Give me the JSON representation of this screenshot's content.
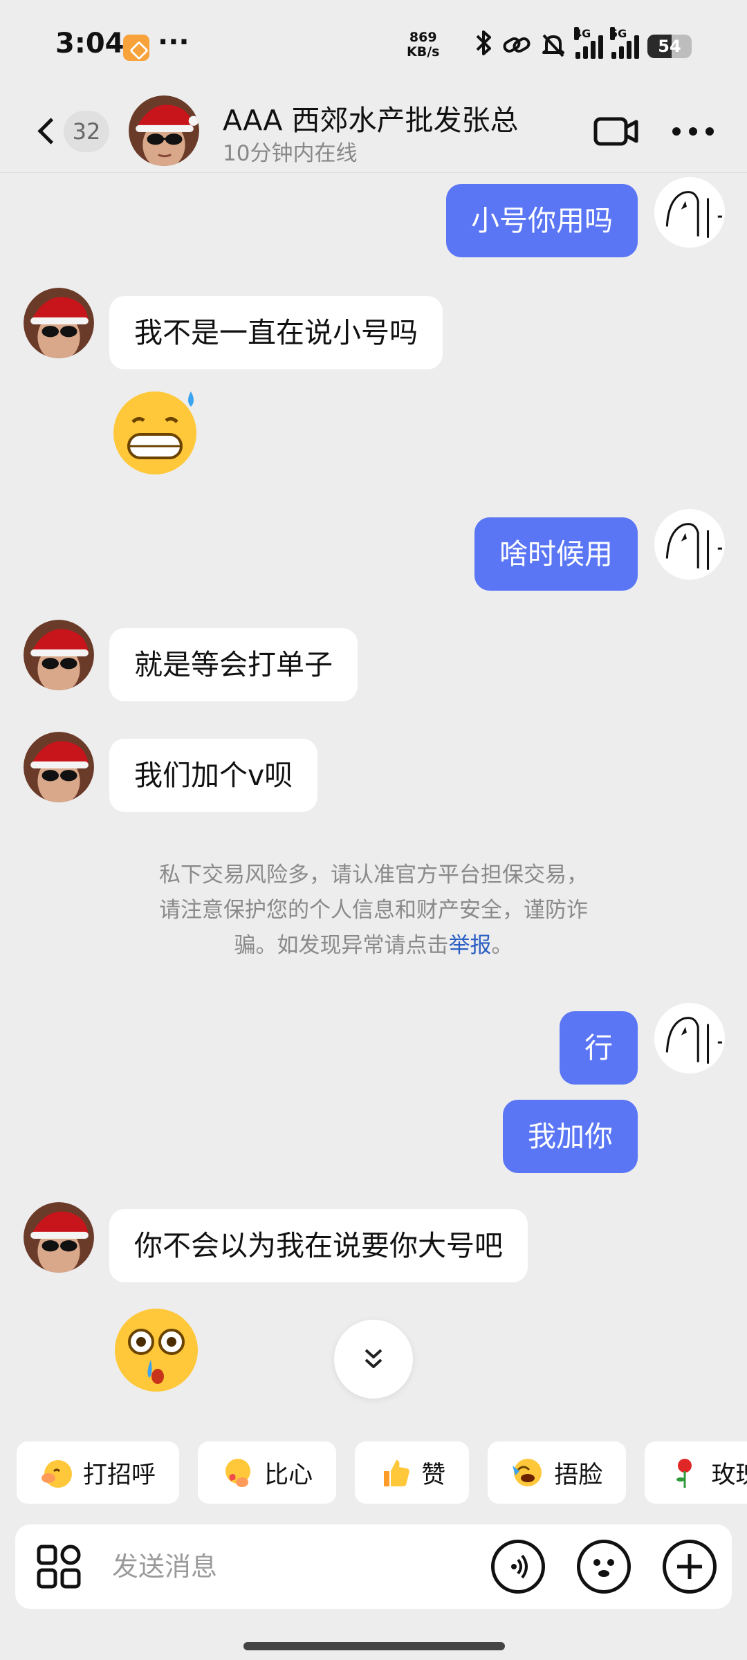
{
  "status_bar": {
    "time": "3:04",
    "speed_value": "869",
    "speed_unit": "KB/s",
    "net1": "4G",
    "net2": "5G",
    "battery": "54",
    "battery_level": 54
  },
  "header": {
    "unread_count": "32",
    "title": "AAA 西郊水产批发张总",
    "subtitle": "10分钟内在线"
  },
  "messages": [
    {
      "side": "out",
      "text": "小号你用吗"
    },
    {
      "side": "in",
      "text": "我不是一直在说小号吗"
    },
    {
      "side": "in",
      "emoji": "grimacing-sweat-emoji"
    },
    {
      "side": "out",
      "text": "啥时候用"
    },
    {
      "side": "in",
      "text": "就是等会打单子"
    },
    {
      "side": "in",
      "text": "我们加个v呗"
    },
    {
      "side": "out",
      "text": "行"
    },
    {
      "side": "out",
      "text": "我加你"
    },
    {
      "side": "in",
      "text": "你不会以为我在说要你大号吧"
    },
    {
      "side": "in",
      "emoji": "flushed-nosebleed-emoji"
    }
  ],
  "notice": {
    "line1": "私下交易风险多，请认准官方平台担保交易，",
    "line2": "请注意保护您的个人信息和财产安全，谨防诈",
    "line3a": "骗。如发现异常请点击",
    "link": "举报",
    "line3b": "。"
  },
  "quick_replies": [
    "打招呼",
    "比心",
    "赞",
    "捂脸",
    "玫瑰"
  ],
  "input": {
    "placeholder": "发送消息"
  },
  "colors": {
    "out_bubble": "#5a76f5",
    "background": "#ededed",
    "link": "#2c5fc4"
  }
}
